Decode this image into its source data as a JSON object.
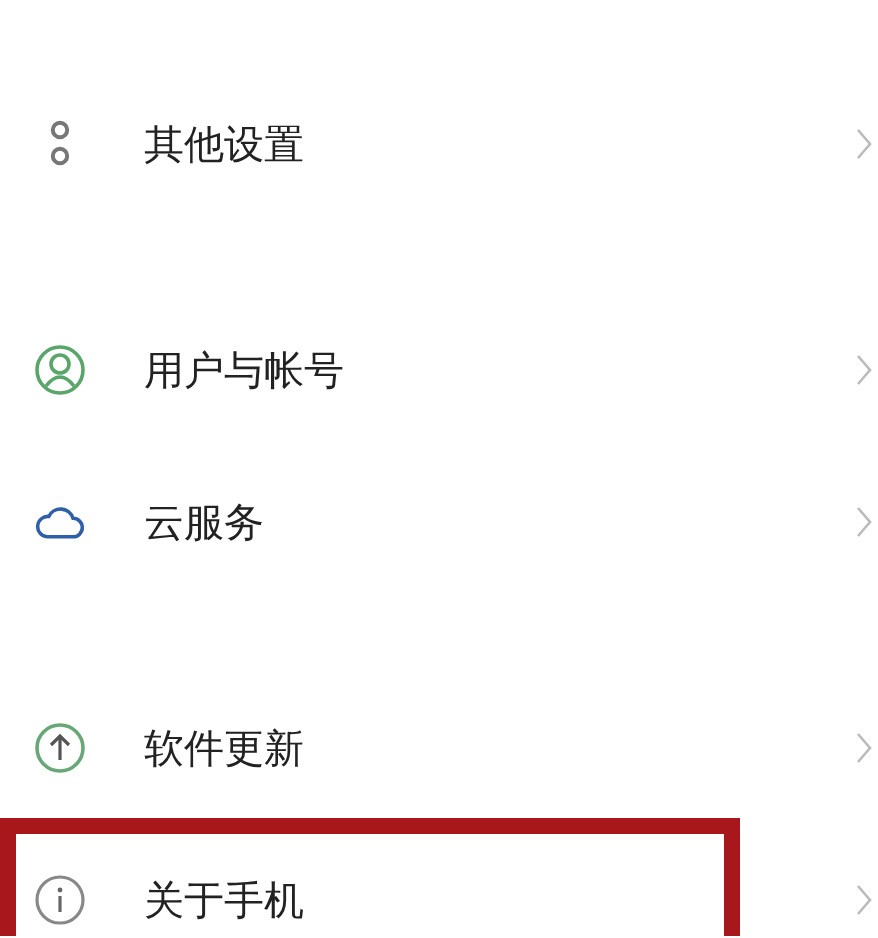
{
  "groups": [
    {
      "items": [
        {
          "kind": "dots",
          "label": "其他设置",
          "highlighted": false
        }
      ]
    },
    {
      "items": [
        {
          "kind": "user",
          "label": "用户与帐号",
          "highlighted": false
        },
        {
          "kind": "cloud",
          "label": "云服务",
          "highlighted": false
        }
      ]
    },
    {
      "items": [
        {
          "kind": "update",
          "label": "软件更新",
          "highlighted": false
        },
        {
          "kind": "info",
          "label": "关于手机",
          "highlighted": true
        }
      ]
    }
  ]
}
